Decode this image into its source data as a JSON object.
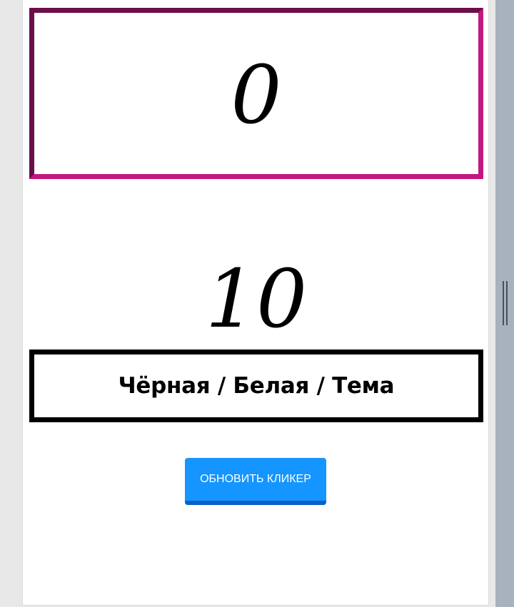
{
  "counter": {
    "value": "0"
  },
  "step": {
    "value": "10"
  },
  "theme_toggle": {
    "label": "Чёрная / Белая / Тема"
  },
  "refresh": {
    "label": "ОБНОВИТЬ КЛИКЕР"
  },
  "colors": {
    "counter_border": "#c2187f",
    "counter_border_shade": "#6b0e4a",
    "button": "#1495ff",
    "button_shadow": "#0b62c8",
    "splitter": "#a8b2be"
  },
  "icons": {
    "splitter_handle": "drag-handle-icon"
  }
}
